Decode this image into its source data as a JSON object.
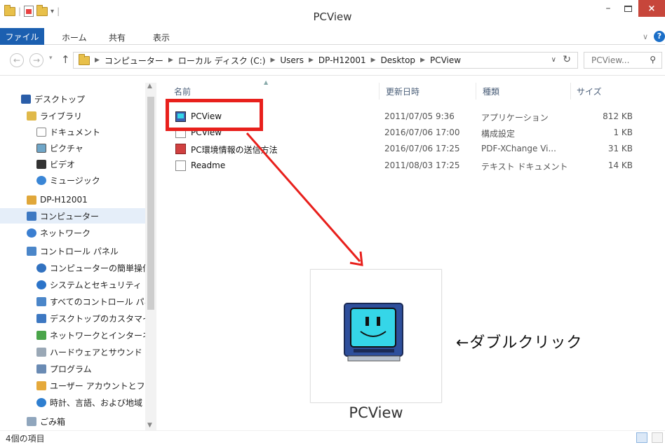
{
  "window": {
    "title": "PCView",
    "minimize": "–",
    "close": "×",
    "qa_divider": "|"
  },
  "ribbon": {
    "tabs": [
      "ファイル",
      "ホーム",
      "共有",
      "表示"
    ]
  },
  "address": {
    "crumbs": [
      "コンピューター",
      "ローカル ディスク (C:)",
      "Users",
      "DP-H12001",
      "Desktop",
      "PCView"
    ],
    "search_placeholder": "PCView..."
  },
  "sidebar": {
    "items": [
      {
        "label": "デスクトップ",
        "icon": "desktop-icon"
      },
      {
        "label": "ライブラリ",
        "icon": "library-icon"
      },
      {
        "label": "ドキュメント",
        "icon": "documents-icon"
      },
      {
        "label": "ピクチャ",
        "icon": "pictures-icon"
      },
      {
        "label": "ビデオ",
        "icon": "videos-icon"
      },
      {
        "label": "ミュージック",
        "icon": "music-icon"
      },
      {
        "label": "DP-H12001",
        "icon": "user-folder-icon"
      },
      {
        "label": "コンピューター",
        "icon": "computer-icon"
      },
      {
        "label": "ネットワーク",
        "icon": "network-icon"
      },
      {
        "label": "コントロール パネル",
        "icon": "control-panel-icon"
      },
      {
        "label": "コンピューターの簡単操作",
        "icon": "ease-of-access-icon"
      },
      {
        "label": "システムとセキュリティ",
        "icon": "system-security-icon"
      },
      {
        "label": "すべてのコントロール パネル",
        "icon": "all-control-panel-icon"
      },
      {
        "label": "デスクトップのカスタマイズ",
        "icon": "personalize-icon"
      },
      {
        "label": "ネットワークとインターネット",
        "icon": "network-internet-icon"
      },
      {
        "label": "ハードウェアとサウンド",
        "icon": "hardware-sound-icon"
      },
      {
        "label": "プログラム",
        "icon": "programs-icon"
      },
      {
        "label": "ユーザー アカウントとファミリー",
        "icon": "user-accounts-icon"
      },
      {
        "label": "時計、言語、および地域",
        "icon": "clock-language-icon"
      },
      {
        "label": "ごみ箱",
        "icon": "recycle-bin-icon"
      }
    ]
  },
  "filelist": {
    "headers": {
      "name": "名前",
      "date": "更新日時",
      "type": "種類",
      "size": "サイズ"
    },
    "rows": [
      {
        "name": "PCView",
        "date": "2011/07/05 9:36",
        "type": "アプリケーション",
        "size": "812 KB",
        "icon": "application-icon"
      },
      {
        "name": "PCView",
        "date": "2016/07/06 17:00",
        "type": "構成設定",
        "size": "1 KB",
        "icon": "config-file-icon"
      },
      {
        "name": "PC環境情報の送信方法",
        "date": "2016/07/06 17:25",
        "type": "PDF-XChange Vi...",
        "size": "31 KB",
        "icon": "pdf-icon"
      },
      {
        "name": "Readme",
        "date": "2011/08/03 17:25",
        "type": "テキスト ドキュメント",
        "size": "14 KB",
        "icon": "text-file-icon"
      }
    ]
  },
  "callout": {
    "caption": "PCView",
    "instruction": "←ダブルクリック"
  },
  "status": {
    "item_count": "4個の項目"
  },
  "colors": {
    "accent": "#1b5fb0",
    "highlight": "#e8201c",
    "app_screen": "#35d6e8"
  }
}
